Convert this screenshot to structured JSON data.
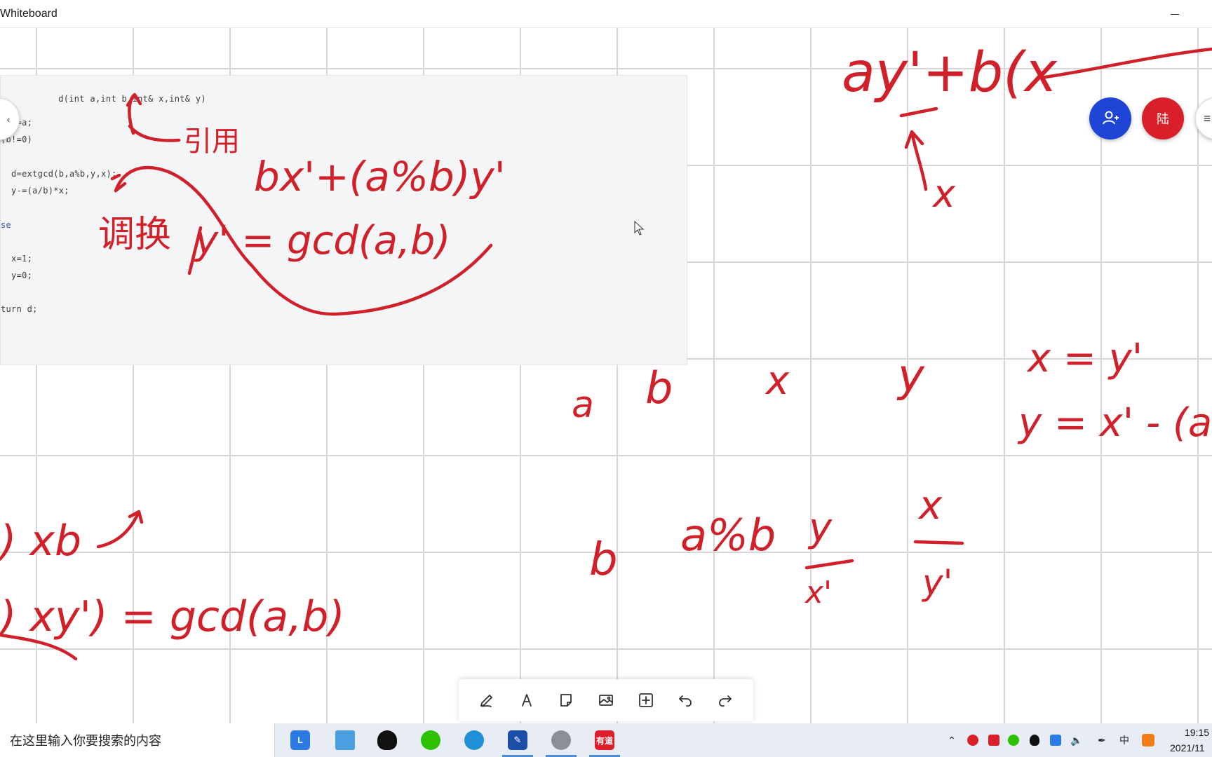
{
  "window": {
    "title": "Whiteboard"
  },
  "code_snippet": {
    "lines": [
      "d(int a,int b,int& x,int& y)",
      "t d=a;",
      "(b!=0)",
      "  d=extgcd(b,a%b,y,x);",
      "  y-=(a/b)*x;",
      "se",
      "  x=1;",
      "  y=0;",
      "turn d;"
    ]
  },
  "ink_annotations": {
    "ref_note": "引用",
    "swap_note": "调换",
    "expr_1": "bx'+(a%b)y'",
    "expr_2": "y' = gcd(a,b)",
    "top_expr": "ay'+b(x",
    "top_arrow_label": "x",
    "vars_row": [
      "a",
      "b",
      "x",
      "y"
    ],
    "eq_1": "x = y'",
    "eq_2": "y = x' - (a",
    "row2": [
      "b",
      "a%b"
    ],
    "frac_1": {
      "num": "y",
      "den": "x'"
    },
    "frac_2": {
      "num": "x",
      "den": "y'"
    },
    "bottom_1": ") xb",
    "bottom_2": ") xy') = gcd(a,b)"
  },
  "collab": {
    "avatar_text": "陆",
    "invite_icon": "add-person-icon",
    "menu_icon": "menu-icon"
  },
  "toolbar": {
    "tools": [
      "pen-icon",
      "text-icon",
      "sticky-note-icon",
      "image-icon",
      "add-icon",
      "undo-icon",
      "redo-icon"
    ]
  },
  "taskbar": {
    "search_placeholder": "在这里输入你要搜索的内容",
    "apps": [
      "lenovo-app-icon",
      "computer-icon",
      "qq-icon",
      "wechat-icon",
      "edge-icon",
      "whiteboard-app-icon",
      "avatar-app-icon",
      "youdao-icon"
    ],
    "youdao_label": "有道",
    "ime_label": "中",
    "clock_time": "19:15",
    "clock_date": "2021/11"
  },
  "colors": {
    "ink": "#d0202a",
    "invite": "#1f45d6",
    "avatar": "#d9202a",
    "grid": "#d7d7d7"
  }
}
